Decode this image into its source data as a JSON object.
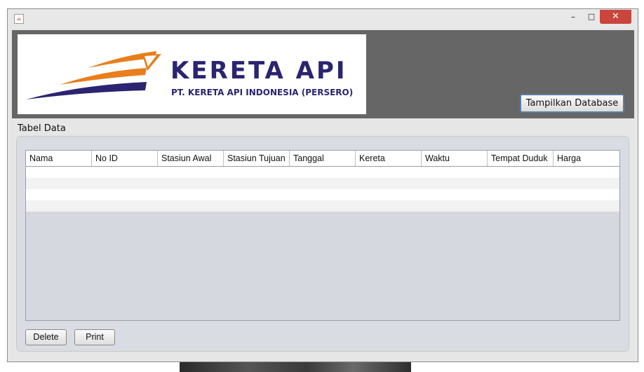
{
  "window": {
    "icon": "java-cup-icon",
    "controls": {
      "minimize": "–",
      "maximize": "□",
      "close": "✕"
    }
  },
  "header": {
    "logo": {
      "title": "KERETA API",
      "subtitle": "PT. KERETA API INDONESIA (PERSERO)",
      "colors": {
        "navy": "#2b2470",
        "orange": "#e87e1c"
      }
    },
    "show_database_label": "Tampilkan Database"
  },
  "section": {
    "label": "Tabel Data"
  },
  "table": {
    "columns": [
      "Nama",
      "No ID",
      "Stasiun Awal",
      "Stasiun Tujuan",
      "Tanggal",
      "Kereta",
      "Waktu",
      "Tempat Duduk",
      "Harga"
    ],
    "rows": [
      [
        "",
        "",
        "",
        "",
        "",
        "",
        "",
        "",
        ""
      ],
      [
        "",
        "",
        "",
        "",
        "",
        "",
        "",
        "",
        ""
      ],
      [
        "",
        "",
        "",
        "",
        "",
        "",
        "",
        "",
        ""
      ],
      [
        "",
        "",
        "",
        "",
        "",
        "",
        "",
        "",
        ""
      ]
    ]
  },
  "actions": {
    "delete_label": "Delete",
    "print_label": "Print"
  }
}
